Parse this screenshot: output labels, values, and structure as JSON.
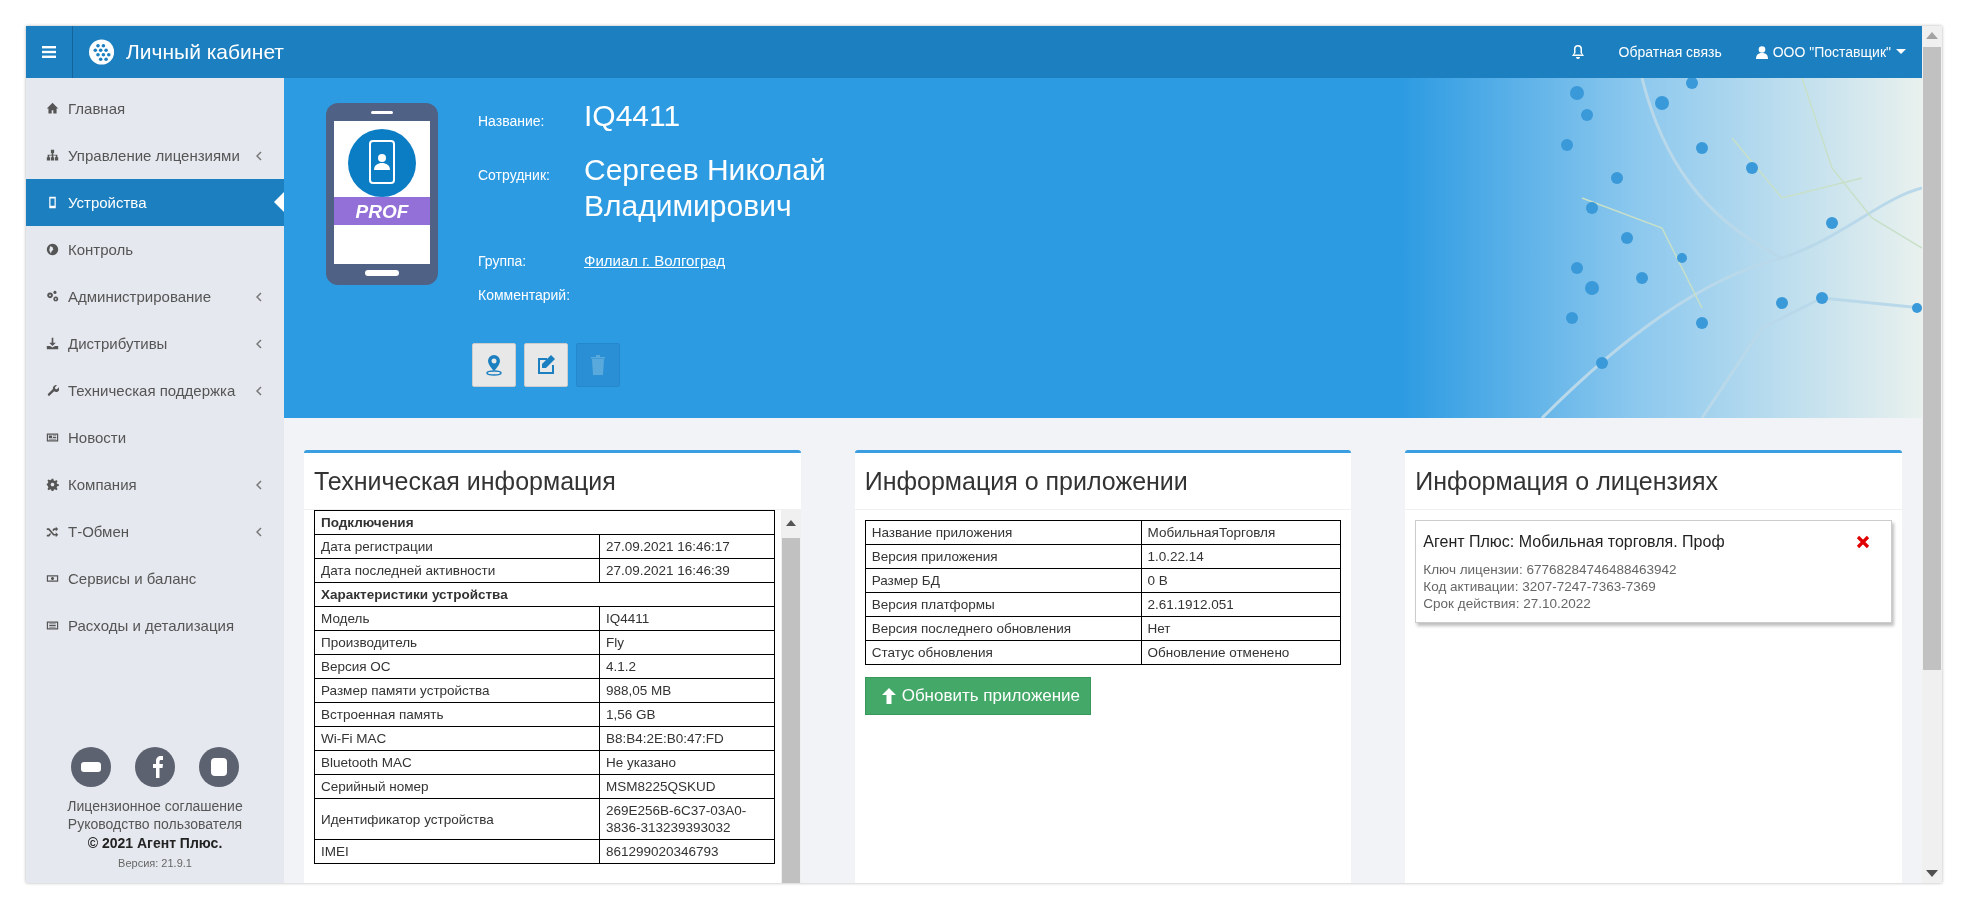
{
  "topbar": {
    "title": "Личный кабинет",
    "feedback": "Обратная связь",
    "user": "ООО \"Поставщик\""
  },
  "sidebar": {
    "items": [
      {
        "label": "Главная",
        "expandable": false,
        "selected": false
      },
      {
        "label": "Управление лицензиями",
        "expandable": true,
        "selected": false
      },
      {
        "label": "Устройства",
        "expandable": false,
        "selected": true
      },
      {
        "label": "Контроль",
        "expandable": false,
        "selected": false
      },
      {
        "label": "Администрирование",
        "expandable": true,
        "selected": false
      },
      {
        "label": "Дистрибутивы",
        "expandable": true,
        "selected": false
      },
      {
        "label": "Техническая поддержка",
        "expandable": true,
        "selected": false
      },
      {
        "label": "Новости",
        "expandable": false,
        "selected": false
      },
      {
        "label": "Компания",
        "expandable": true,
        "selected": false
      },
      {
        "label": "Т-Обмен",
        "expandable": true,
        "selected": false
      },
      {
        "label": "Сервисы и баланс",
        "expandable": false,
        "selected": false
      },
      {
        "label": "Расходы и детализация",
        "expandable": false,
        "selected": false
      }
    ],
    "footer": {
      "links": [
        "Лицензионное соглашение",
        "Руководство пользователя"
      ],
      "copyright": "© 2021 Агент Плюс.",
      "version": "Версия: 21.9.1"
    }
  },
  "device": {
    "badge": "PROF",
    "fields": [
      {
        "kind": "title",
        "label": "Название:",
        "value": "IQ4411"
      },
      {
        "kind": "title",
        "label": "Сотрудник:",
        "value": "Сергеев Николай Владимирович"
      },
      {
        "kind": "link",
        "label": "Группа:",
        "value": "Филиал г. Волгоград"
      },
      {
        "kind": "text",
        "label": "Комментарий:"
      }
    ],
    "actions": [
      {
        "kind": "location",
        "disabled": false
      },
      {
        "kind": "edit",
        "disabled": false
      },
      {
        "kind": "delete",
        "disabled": true
      }
    ]
  },
  "tech_info": {
    "title": "Техническая информация",
    "sections": [
      {
        "title": "Подключения",
        "rows": [
          {
            "label": "Дата регистрации",
            "value": "27.09.2021 16:46:17"
          },
          {
            "label": "Дата последней активности",
            "value": "27.09.2021 16:46:39"
          }
        ]
      },
      {
        "title": "Характеристики устройства",
        "rows": [
          {
            "label": "Модель",
            "value": "IQ4411"
          },
          {
            "label": "Производитель",
            "value": "Fly"
          },
          {
            "label": "Версия ОС",
            "value": "4.1.2"
          },
          {
            "label": "Размер памяти устройства",
            "value": "988,05 MB"
          },
          {
            "label": "Встроенная память",
            "value": "1,56 GB"
          },
          {
            "label": "Wi-Fi MAC",
            "value": "B8:B4:2E:B0:47:FD"
          },
          {
            "label": "Bluetooth MAC",
            "value": "Не указано"
          },
          {
            "label": "Серийный номер",
            "value": "MSM8225QSKUD"
          },
          {
            "label": "Идентификатор устройства",
            "value": "269E256B-6C37-03A0-3836-313239393032"
          },
          {
            "label": "IMEI",
            "value": "861299020346793"
          }
        ]
      }
    ]
  },
  "app_info": {
    "title": "Информация о приложении",
    "rows": [
      {
        "label": "Название приложения",
        "value": "МобильнаяТорговля"
      },
      {
        "label": "Версия приложения",
        "value": "1.0.22.14"
      },
      {
        "label": "Размер БД",
        "value": "0 B"
      },
      {
        "label": "Версия платформы",
        "value": "2.61.1912.051"
      },
      {
        "label": "Версия последнего обновления",
        "value": "Нет"
      },
      {
        "label": "Статус обновления",
        "value": "Обновление отменено"
      }
    ],
    "button": "Обновить приложение"
  },
  "licenses": {
    "title": "Информация о лицензиях",
    "items": [
      {
        "name": "Агент Плюс: Мобильная торговля. Проф",
        "lines": [
          "Ключ лицензии: 67768284746488463942",
          "Код активации: 3207-7247-7363-7369",
          "Срок действия: 27.10.2022"
        ]
      }
    ]
  }
}
